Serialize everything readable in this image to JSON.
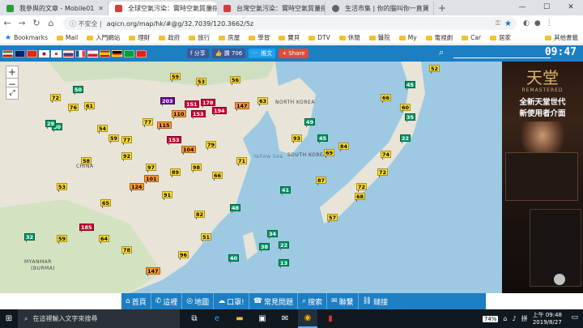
{
  "browser": {
    "tabs": [
      {
        "title": "我參與的文章 - Mobile01",
        "color": "#2a9d3a",
        "active": false
      },
      {
        "title": "全球空氣污染：實時空氣質量指數",
        "color": "#d93a3a",
        "active": true
      },
      {
        "title": "台灣空氣污染：實時空氣質量指數",
        "color": "#d93a3a",
        "active": false
      },
      {
        "title": "生活市集 | 你的腦叫你一直買",
        "color": "#5f6368",
        "active": false
      }
    ],
    "security_label": "不安全",
    "url": "aqicn.org/map/hk/#@g/32.7039/120.3662/5z",
    "bookmarks": [
      "Bookmarks",
      "Mail",
      "入門網站",
      "理財",
      "政府",
      "旅行",
      "房屋",
      "學習",
      "寶貝",
      "DTV",
      "休閒",
      "醫院",
      "My",
      "電視劇",
      "Car",
      "居家"
    ],
    "other_bookmarks": "其他書籤"
  },
  "site": {
    "share_label": "分享",
    "like_label": "讚 706",
    "tweet_label": "推文",
    "plus_label": "Share",
    "time": "09:47",
    "nav": [
      {
        "icon": "home-icon",
        "glyph": "⌂",
        "label": "首頁"
      },
      {
        "icon": "chat-icon",
        "glyph": "✆",
        "label": "這裡"
      },
      {
        "icon": "map-icon",
        "glyph": "◎",
        "label": "地圖"
      },
      {
        "icon": "mask-icon",
        "glyph": "☁",
        "label": "口罩!"
      },
      {
        "icon": "faq-icon",
        "glyph": "☎",
        "label": "常見問題"
      },
      {
        "icon": "search-icon",
        "glyph": "⌕",
        "label": "搜索"
      },
      {
        "icon": "link-icon",
        "glyph": "✉",
        "label": "聯繫"
      },
      {
        "icon": "chain-icon",
        "glyph": "⛓",
        "label": "鏈接"
      }
    ]
  },
  "map": {
    "labels": [
      "CHINA",
      "NORTH KOREA",
      "SOUTH KOREA",
      "MYANMAR",
      "(BURMA)",
      "Yellow Sea"
    ],
    "markers": [
      {
        "v": "72"
      },
      {
        "v": "50"
      },
      {
        "v": "76"
      },
      {
        "v": "50"
      },
      {
        "v": "59"
      },
      {
        "v": "53"
      },
      {
        "v": "56"
      },
      {
        "v": "110"
      },
      {
        "v": "151"
      },
      {
        "v": "153"
      },
      {
        "v": "178"
      },
      {
        "v": "194"
      },
      {
        "v": "147"
      },
      {
        "v": "63"
      },
      {
        "v": "54"
      },
      {
        "v": "59"
      },
      {
        "v": "77"
      },
      {
        "v": "115"
      },
      {
        "v": "153"
      },
      {
        "v": "104"
      },
      {
        "v": "79"
      },
      {
        "v": "58"
      },
      {
        "v": "92"
      },
      {
        "v": "97"
      },
      {
        "v": "89"
      },
      {
        "v": "98"
      },
      {
        "v": "66"
      },
      {
        "v": "71"
      },
      {
        "v": "53"
      },
      {
        "v": "124"
      },
      {
        "v": "65"
      },
      {
        "v": "91"
      },
      {
        "v": "185"
      },
      {
        "v": "82"
      },
      {
        "v": "48"
      },
      {
        "v": "32"
      },
      {
        "v": "59"
      },
      {
        "v": "64"
      },
      {
        "v": "78"
      },
      {
        "v": "147"
      },
      {
        "v": "96"
      },
      {
        "v": "51"
      },
      {
        "v": "40"
      },
      {
        "v": "34"
      },
      {
        "v": "22"
      },
      {
        "v": "13"
      },
      {
        "v": "49"
      },
      {
        "v": "45"
      },
      {
        "v": "29"
      },
      {
        "v": "66"
      },
      {
        "v": "60"
      },
      {
        "v": "22"
      },
      {
        "v": "72"
      },
      {
        "v": "72"
      },
      {
        "v": "84"
      },
      {
        "v": "69"
      },
      {
        "v": "68"
      },
      {
        "v": "87"
      },
      {
        "v": "93"
      },
      {
        "v": "74"
      },
      {
        "v": "45"
      },
      {
        "v": "35"
      },
      {
        "v": "52"
      },
      {
        "v": "38"
      },
      {
        "v": "77"
      },
      {
        "v": "61"
      },
      {
        "v": "41"
      },
      {
        "v": "57"
      },
      {
        "v": "101"
      },
      {
        "v": "203"
      }
    ]
  },
  "ad": {
    "title": "天堂",
    "subtitle": "REMASTERED",
    "line1": "全新天堂世代",
    "line2": "新使用者介面"
  },
  "taskbar": {
    "search_placeholder": "在這裡輸入文字來搜尋",
    "battery": "74%",
    "ampm": "上午",
    "clock": "09:48",
    "date": "2019/8/27"
  }
}
